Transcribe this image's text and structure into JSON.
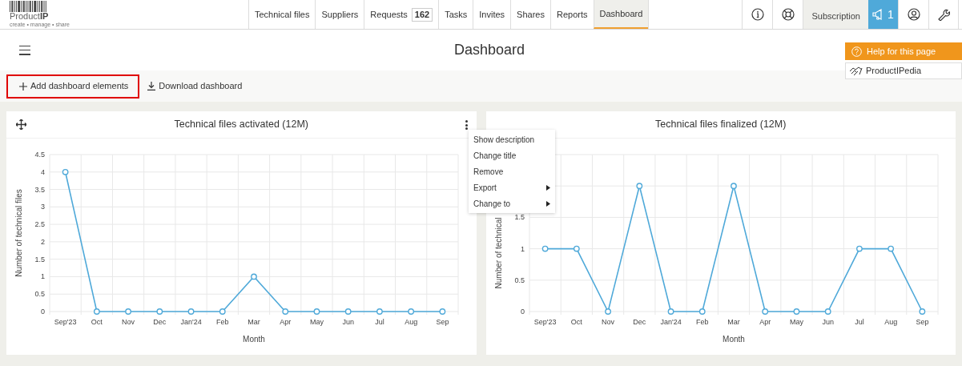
{
  "logo": {
    "brand": "Product",
    "brand_strong": "IP",
    "tagline": "create • manage • share"
  },
  "nav": [
    {
      "label": "Technical files",
      "selected": false
    },
    {
      "label": "Suppliers",
      "selected": false
    },
    {
      "label": "Requests",
      "badge": "162",
      "selected": false
    },
    {
      "label": "Tasks",
      "selected": false
    },
    {
      "label": "Invites",
      "selected": false
    },
    {
      "label": "Shares",
      "selected": false
    },
    {
      "label": "Reports",
      "selected": false
    },
    {
      "label": "Dashboard",
      "selected": true
    }
  ],
  "nav_right": {
    "subscription": "Subscription",
    "announcements": "1"
  },
  "page_title": "Dashboard",
  "help_panel": {
    "help": "Help for this page",
    "wiki": "ProductIPedia"
  },
  "toolbar": [
    {
      "label": "Add dashboard elements",
      "kind": "add",
      "highlighted": true
    },
    {
      "label": "Download dashboard",
      "kind": "download",
      "highlighted": false
    }
  ],
  "widgets": [
    {
      "movable": true,
      "menu_button": true,
      "chart_data": {
        "type": "line",
        "grid": true,
        "title": "Technical files activated (12M)",
        "xlabel": "Month",
        "ylabel": "Number of technical files",
        "categories": [
          "Sep'23",
          "Oct",
          "Nov",
          "Dec",
          "Jan'24",
          "Feb",
          "Mar",
          "Apr",
          "May",
          "Jun",
          "Jul",
          "Aug",
          "Sep"
        ],
        "ylim": [
          0,
          4.5
        ],
        "yticks": [
          0,
          0.5,
          1,
          1.5,
          2,
          2.5,
          3,
          3.5,
          4,
          4.5
        ],
        "series": [
          {
            "color": "#4fa9d9",
            "marker": "circle",
            "values": [
              4,
              0,
              0,
              0,
              0,
              0,
              1,
              0,
              0,
              0,
              0,
              0,
              0
            ]
          }
        ]
      }
    },
    {
      "movable": false,
      "menu_button": false,
      "chart_data": {
        "type": "line",
        "grid": true,
        "title": "Technical files finalized (12M)",
        "xlabel": "Month",
        "ylabel": "Number of technical",
        "categories": [
          "Sep'23",
          "Oct",
          "Nov",
          "Dec",
          "Jan'24",
          "Feb",
          "Mar",
          "Apr",
          "May",
          "Jun",
          "Jul",
          "Aug",
          "Sep"
        ],
        "ylim": [
          0,
          2.5
        ],
        "yticks": [
          0,
          0.5,
          1,
          1.5
        ],
        "series": [
          {
            "color": "#4fa9d9",
            "marker": "circle",
            "values": [
              1,
              1,
              0,
              2,
              0,
              0,
              2,
              0,
              0,
              0,
              1,
              1,
              0
            ]
          }
        ]
      }
    }
  ],
  "context_menu": [
    {
      "label": "Show description",
      "submenu": false
    },
    {
      "label": "Change title",
      "submenu": false
    },
    {
      "label": "Remove",
      "submenu": false
    },
    {
      "label": "Export",
      "submenu": true
    },
    {
      "label": "Change to",
      "submenu": true
    }
  ]
}
